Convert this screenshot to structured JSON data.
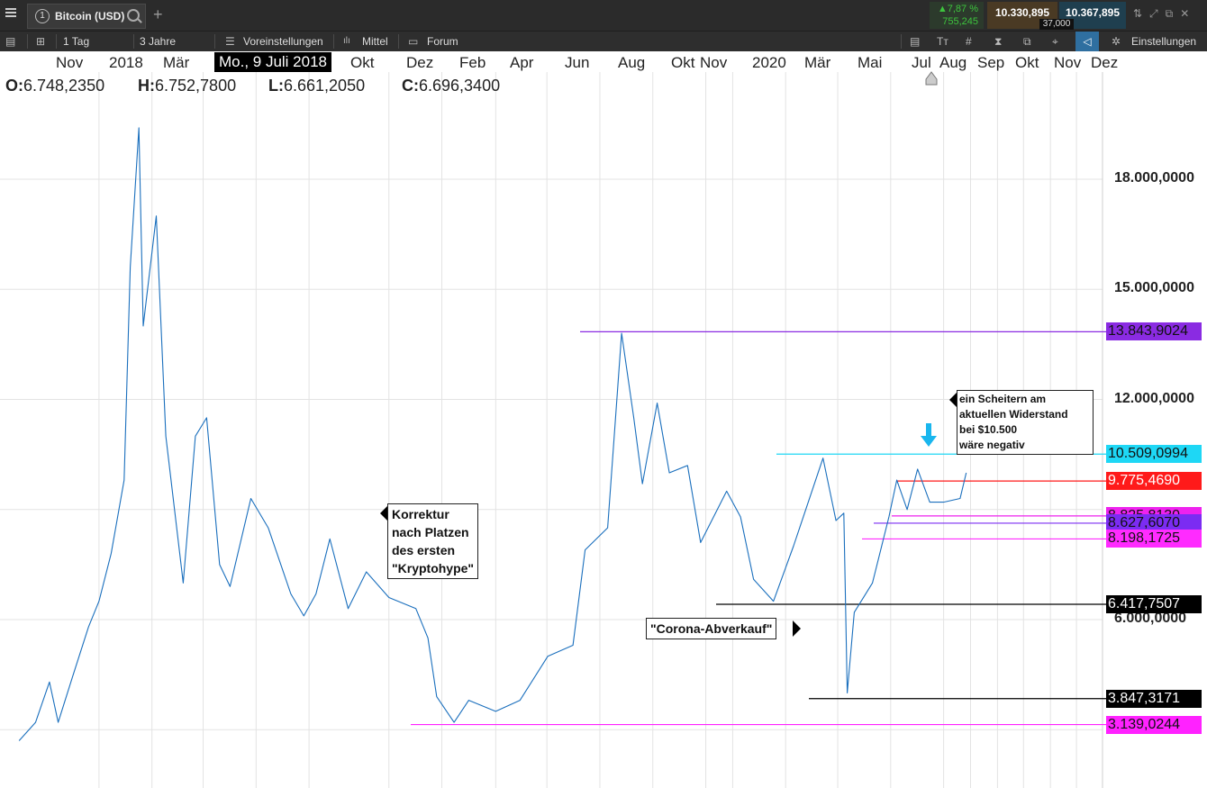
{
  "topbar": {
    "symbol_index": "1",
    "symbol": "Bitcoin (USD)",
    "change_pct": "▲7,87 %",
    "change_abs": "755,245",
    "bid": "10.330,895",
    "ask": "10.367,895",
    "spread": "37,000"
  },
  "toolbar": {
    "interval": "1 Tag",
    "range": "3 Jahre",
    "presets": "Voreinstellungen",
    "average": "Mittel",
    "forum": "Forum",
    "settings": "Einstellungen"
  },
  "cursor": {
    "date_label": "Mo., 9 Juli 2018",
    "ohlc": [
      {
        "key": "O:",
        "value": "6.748,2350"
      },
      {
        "key": "H:",
        "value": "6.752,7800"
      },
      {
        "key": "L:",
        "value": "6.661,2050"
      },
      {
        "key": "C:",
        "value": "6.696,3400"
      }
    ]
  },
  "chart_data": {
    "type": "line",
    "title": "",
    "xlabel": "",
    "ylabel": "",
    "ylim": [
      2100,
      19400
    ],
    "grid": true,
    "x_tick_labels": [
      "Nov",
      "2018",
      "Mär",
      "Mai",
      "Jul",
      "Okt",
      "Dez",
      "Feb",
      "Apr",
      "Jun",
      "Aug",
      "Okt",
      "Nov",
      "2020",
      "Mär",
      "Mai",
      "Jul",
      "Aug",
      "Sep",
      "Okt",
      "Nov",
      "Dez"
    ],
    "y_tick_labels": [
      "18.000,0000",
      "15.000,0000",
      "12.000,0000",
      "6.000,0000"
    ],
    "y_ticks": [
      18000,
      15000,
      12000,
      6000
    ],
    "series": [
      {
        "x": [
          "2017-08-01",
          "2017-08-20",
          "2017-09-05",
          "2017-09-15",
          "2017-10-01",
          "2017-10-20",
          "2017-11-01",
          "2017-11-15",
          "2017-11-30",
          "2017-12-07",
          "2017-12-17",
          "2017-12-22",
          "2018-01-06",
          "2018-01-17",
          "2018-02-06",
          "2018-02-20",
          "2018-03-05",
          "2018-03-20",
          "2018-04-01",
          "2018-04-25",
          "2018-05-15",
          "2018-06-10",
          "2018-06-25",
          "2018-07-09",
          "2018-07-25",
          "2018-08-15",
          "2018-09-05",
          "2018-10-01",
          "2018-11-01",
          "2018-11-15",
          "2018-11-25",
          "2018-12-15",
          "2019-01-01",
          "2019-02-01",
          "2019-03-01",
          "2019-04-02",
          "2019-05-01",
          "2019-05-15",
          "2019-06-10",
          "2019-06-26",
          "2019-07-10",
          "2019-07-20",
          "2019-08-06",
          "2019-08-20",
          "2019-09-10",
          "2019-09-25",
          "2019-10-25",
          "2019-11-10",
          "2019-11-25",
          "2019-12-18",
          "2020-01-10",
          "2020-02-13",
          "2020-02-28",
          "2020-03-08",
          "2020-03-12",
          "2020-03-20",
          "2020-04-10",
          "2020-04-29",
          "2020-05-08",
          "2020-05-20",
          "2020-06-01",
          "2020-06-15",
          "2020-07-01",
          "2020-07-20",
          "2020-07-27"
        ],
        "values": [
          2700,
          3200,
          4300,
          3200,
          4400,
          5800,
          6500,
          7800,
          9800,
          15600,
          19400,
          14000,
          17000,
          11000,
          7000,
          11000,
          11500,
          7500,
          6900,
          9300,
          8500,
          6700,
          6100,
          6700,
          8200,
          6300,
          7300,
          6600,
          6300,
          5500,
          3900,
          3200,
          3800,
          3500,
          3800,
          5000,
          5300,
          7900,
          8500,
          13800,
          11500,
          9700,
          11900,
          10000,
          10200,
          8100,
          9500,
          8800,
          7100,
          6500,
          8000,
          10400,
          8700,
          8900,
          4000,
          6200,
          7000,
          8800,
          9800,
          9000,
          10100,
          9200,
          9200,
          9300,
          10000
        ]
      }
    ],
    "price_levels": [
      {
        "value": 13843.9024,
        "label": "13.843,9024",
        "color": "#8a2be2"
      },
      {
        "value": 10509.0994,
        "label": "10.509,0994",
        "color": "#1ed7f5"
      },
      {
        "value": 9775.469,
        "label": "9.775,4690",
        "color": "#ff1a1a"
      },
      {
        "value": 8825.813,
        "label": "8.825,8130",
        "color": "#ee22ee"
      },
      {
        "value": 8627.607,
        "label": "8.627,6070",
        "color": "#7b2cf2"
      },
      {
        "value": 8198.1725,
        "label": "8.198,1725",
        "color": "#ff2bff"
      },
      {
        "value": 6417.7507,
        "label": "6.417,7507",
        "color": "#000000"
      },
      {
        "value": 3847.3171,
        "label": "3.847,3171",
        "color": "#000000"
      },
      {
        "value": 3139.0244,
        "label": "3.139,0244",
        "color": "#ff22ff"
      }
    ],
    "annotations": [
      {
        "lines": [
          "Korrektur",
          "nach Platzen",
          "des ersten",
          "\"Kryptohype\""
        ]
      },
      {
        "lines": [
          "\"Corona-Abverkauf\""
        ]
      },
      {
        "lines": [
          "ein Scheitern am",
          "aktuellen Widerstand",
          "bei $10.500",
          "wäre negativ"
        ]
      }
    ]
  }
}
